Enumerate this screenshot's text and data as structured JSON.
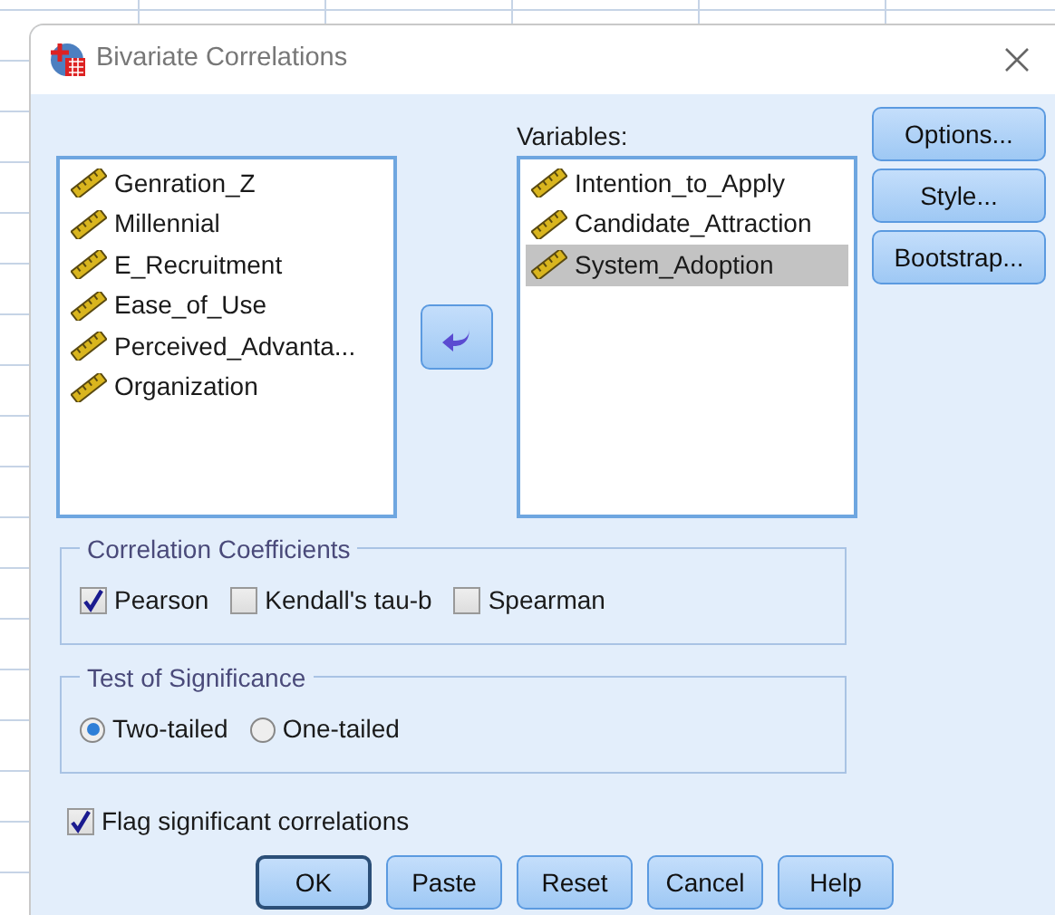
{
  "window": {
    "title": "Bivariate Correlations"
  },
  "source_list": {
    "items": [
      {
        "label": "Genration_Z",
        "selected": false
      },
      {
        "label": "Millennial",
        "selected": false
      },
      {
        "label": "E_Recruitment",
        "selected": false
      },
      {
        "label": "Ease_of_Use",
        "selected": false
      },
      {
        "label": "Perceived_Advanta...",
        "selected": false
      },
      {
        "label": "Organization",
        "selected": false
      }
    ]
  },
  "variables": {
    "label": "Variables:",
    "items": [
      {
        "label": "Intention_to_Apply",
        "selected": false
      },
      {
        "label": "Candidate_Attraction",
        "selected": false
      },
      {
        "label": "System_Adoption",
        "selected": true
      }
    ]
  },
  "side_buttons": [
    "Options...",
    "Style...",
    "Bootstrap..."
  ],
  "correlation_coefficients": {
    "title": "Correlation Coefficients",
    "options": [
      {
        "label": "Pearson",
        "checked": true
      },
      {
        "label": "Kendall's tau-b",
        "checked": false
      },
      {
        "label": "Spearman",
        "checked": false
      }
    ]
  },
  "test_of_significance": {
    "title": "Test of Significance",
    "options": [
      {
        "label": "Two-tailed",
        "selected": true
      },
      {
        "label": "One-tailed",
        "selected": false
      }
    ]
  },
  "flag_significant": {
    "label": "Flag significant correlations",
    "checked": true
  },
  "buttons": [
    {
      "label": "OK",
      "default": true
    },
    {
      "label": "Paste",
      "default": false
    },
    {
      "label": "Reset",
      "default": false
    },
    {
      "label": "Cancel",
      "default": false
    },
    {
      "label": "Help",
      "default": false
    }
  ]
}
